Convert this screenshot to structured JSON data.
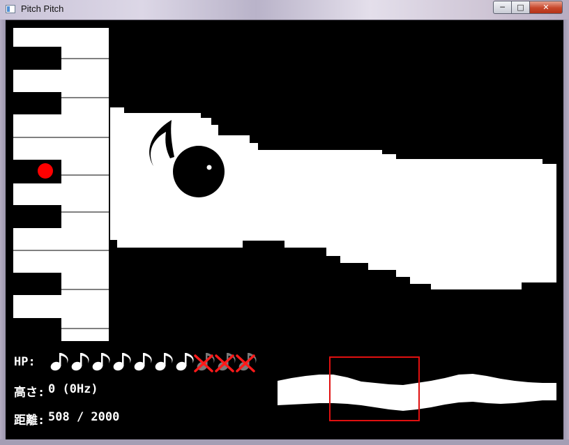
{
  "window": {
    "title": "Pitch Pitch",
    "min_glyph": "─",
    "max_glyph": "□",
    "close_glyph": "✕"
  },
  "hud": {
    "hp_label": "HP:",
    "hp_total": 10,
    "hp_remaining": 7,
    "pitch_label": "高さ:",
    "pitch_value": "0 (0Hz)",
    "distance_label": "距離:",
    "distance_value": "508 / 2000"
  },
  "icons": {
    "hp_full": "eighth-note-icon",
    "hp_lost": "eighth-note-crossed-icon",
    "pitch_marker": "red-dot-icon",
    "player": "eighth-note-player-icon"
  },
  "colors": {
    "background": "#000000",
    "path": "#ffffff",
    "marker": "#ff0000",
    "lost_x": "#ff1a1a",
    "lost_note": "#7a7a7a",
    "minimap_frame": "#e01010"
  },
  "progress": {
    "distance": 508,
    "goal": 2000
  }
}
